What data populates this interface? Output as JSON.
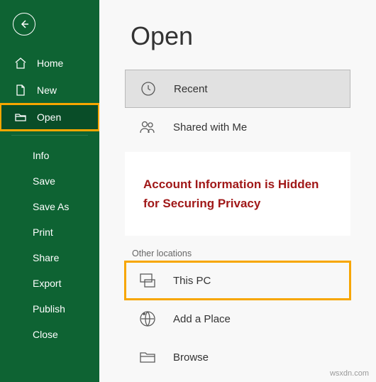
{
  "sidebar": {
    "nav": [
      {
        "label": "Home"
      },
      {
        "label": "New"
      },
      {
        "label": "Open"
      }
    ],
    "sub": [
      {
        "label": "Info"
      },
      {
        "label": "Save"
      },
      {
        "label": "Save As"
      },
      {
        "label": "Print"
      },
      {
        "label": "Share"
      },
      {
        "label": "Export"
      },
      {
        "label": "Publish"
      },
      {
        "label": "Close"
      }
    ]
  },
  "main": {
    "title": "Open",
    "recent": "Recent",
    "shared": "Shared with Me",
    "hidden_msg": "Account Information is Hidden for Securing Privacy",
    "other_locations_label": "Other locations",
    "this_pc": "This PC",
    "add_place": "Add a Place",
    "browse": "Browse"
  },
  "watermark": "wsxdn.com"
}
